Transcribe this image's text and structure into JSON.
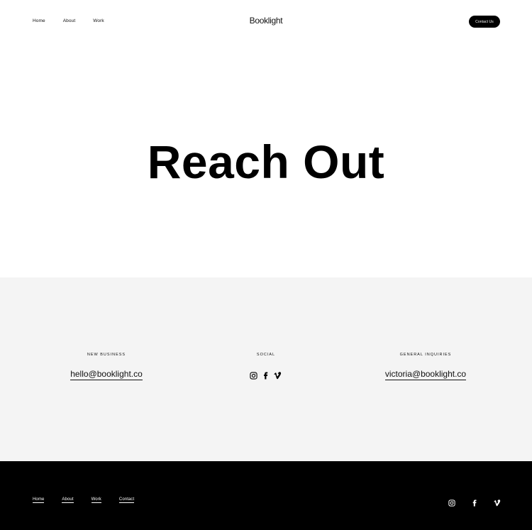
{
  "header": {
    "brand": "Booklight",
    "nav": [
      "Home",
      "About",
      "Work"
    ],
    "cta_label": "Contact Us"
  },
  "hero": {
    "title": "Reach Out"
  },
  "contact": {
    "new_business": {
      "heading": "NEW BUSINESS",
      "email": "hello@booklight.co"
    },
    "social": {
      "heading": "SOCIAL",
      "icons": [
        "instagram-icon",
        "facebook-icon",
        "vimeo-icon"
      ]
    },
    "general": {
      "heading": "GENERAL INQUIRIES",
      "email": "victoria@booklight.co"
    }
  },
  "footer": {
    "nav": [
      "Home",
      "About",
      "Work",
      "Contact"
    ],
    "social_icons": [
      "instagram-icon",
      "facebook-icon",
      "vimeo-icon"
    ]
  },
  "colors": {
    "background": "#ffffff",
    "section": "#f4f4f4",
    "footer": "#000000",
    "text": "#111111"
  }
}
